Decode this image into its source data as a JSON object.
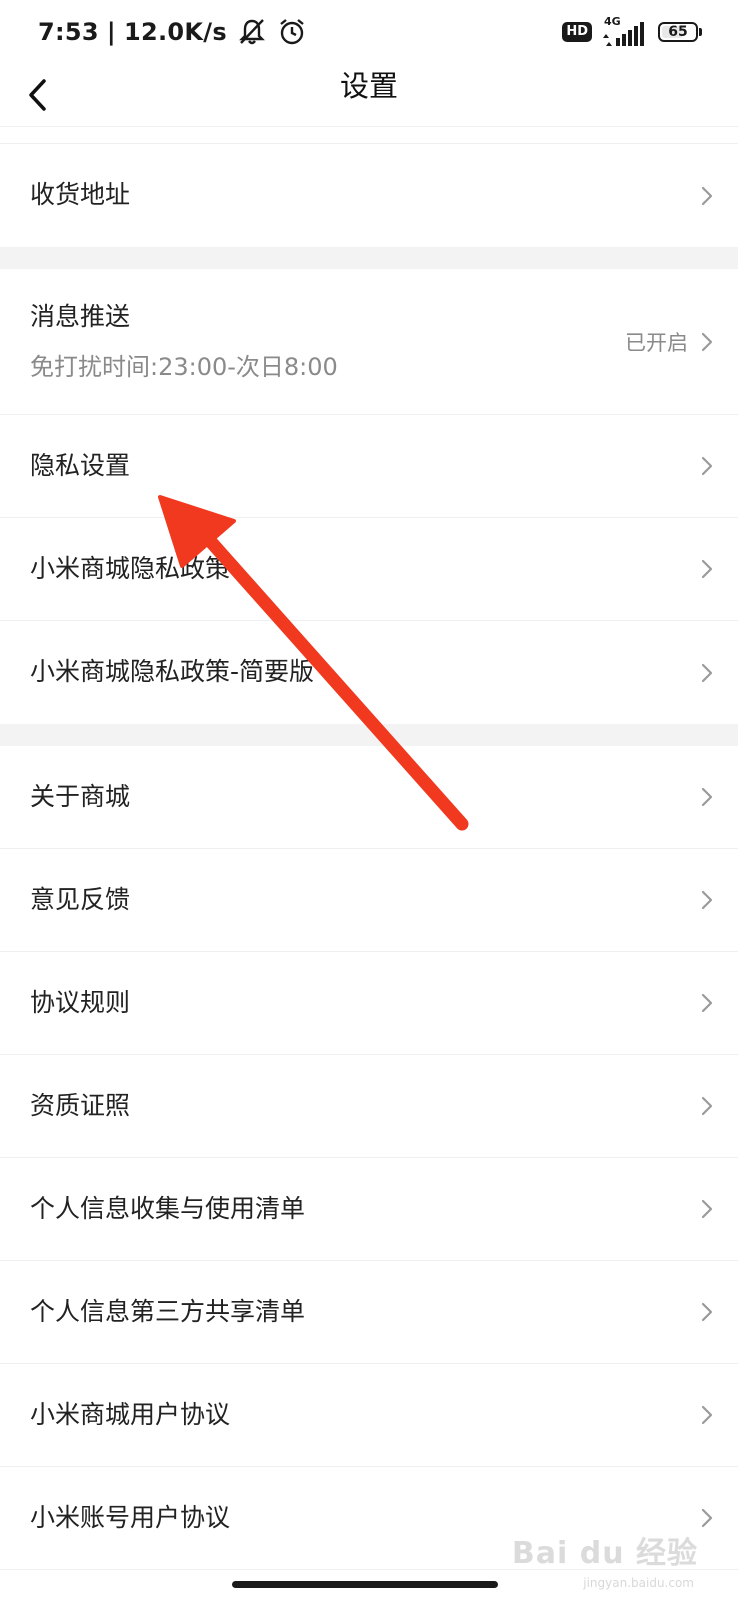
{
  "status_bar": {
    "time": "7:53",
    "separator": "|",
    "speed": "12.0K/s",
    "hd": "HD",
    "network": "4G",
    "battery": "65",
    "battery_level": 0.65
  },
  "header": {
    "title": "设置"
  },
  "address_item": {
    "label": "收货地址"
  },
  "message_item": {
    "label": "消息推送",
    "sub": "免打扰时间:23:00-次日8:00",
    "value": "已开启"
  },
  "privacy_items": [
    {
      "label": "隐私设置"
    },
    {
      "label": "小米商城隐私政策"
    },
    {
      "label": "小米商城隐私政策-简要版"
    }
  ],
  "about_items": [
    {
      "label": "关于商城"
    },
    {
      "label": "意见反馈"
    },
    {
      "label": "协议规则"
    },
    {
      "label": "资质证照"
    },
    {
      "label": "个人信息收集与使用清单"
    },
    {
      "label": "个人信息第三方共享清单"
    },
    {
      "label": "小米商城用户协议"
    },
    {
      "label": "小米账号用户协议"
    }
  ],
  "watermark": {
    "text": "Bai du 经验",
    "sub": "jingyan.baidu.com"
  },
  "colors": {
    "annotation_arrow": "#f0391f",
    "section_gap": "#f3f3f3",
    "secondary_text": "#8a8a8a"
  }
}
